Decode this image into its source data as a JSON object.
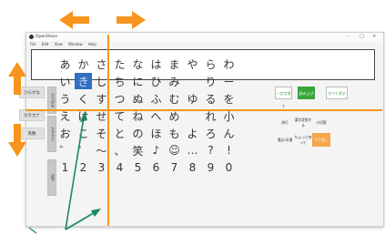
{
  "window": {
    "title": "OpenVoice"
  },
  "menubar": {
    "items": [
      "File",
      "Edit",
      "View",
      "Window",
      "Help"
    ]
  },
  "textbox": {
    "value": ""
  },
  "side_buttons": [
    "ひらがな",
    "カタカナ",
    "英数"
  ],
  "vertical_tabs": [
    "ひらがな",
    "カタカナ",
    "記号"
  ],
  "kana_rows": [
    [
      "あ",
      "か",
      "さ",
      "た",
      "な",
      "は",
      "ま",
      "や",
      "ら",
      "わ"
    ],
    [
      "い",
      "き",
      "し",
      "ち",
      "に",
      "ひ",
      "み",
      "",
      "り",
      "ー"
    ],
    [
      "う",
      "く",
      "す",
      "つ",
      "ぬ",
      "ふ",
      "む",
      "ゆ",
      "る",
      "を"
    ],
    [
      "え",
      "け",
      "せ",
      "て",
      "ね",
      "へ",
      "め",
      "",
      "れ",
      "小"
    ],
    [
      "お",
      "こ",
      "そ",
      "と",
      "の",
      "ほ",
      "も",
      "よ",
      "ろ",
      "ん"
    ],
    [
      "゛",
      "゜",
      "〜",
      "、",
      "笑",
      "♪",
      "☺",
      "…",
      "?",
      "!"
    ],
    [
      "1",
      "2",
      "3",
      "4",
      "5",
      "6",
      "7",
      "8",
      "9",
      "0"
    ]
  ],
  "selected_key": "き",
  "right_panel": {
    "top_buttons": [
      "一文字消す",
      "読み上げ",
      "すべて消す"
    ],
    "small_buttons": [
      [
        "改行",
        "漢字変換する",
        "小切替"
      ],
      [
        "濁点/半濁",
        "ちょっと待って",
        "やり直し"
      ]
    ]
  },
  "colors": {
    "orange": "#f7941d",
    "green": "#1a8a5a",
    "selected": "#2f6fc0"
  }
}
